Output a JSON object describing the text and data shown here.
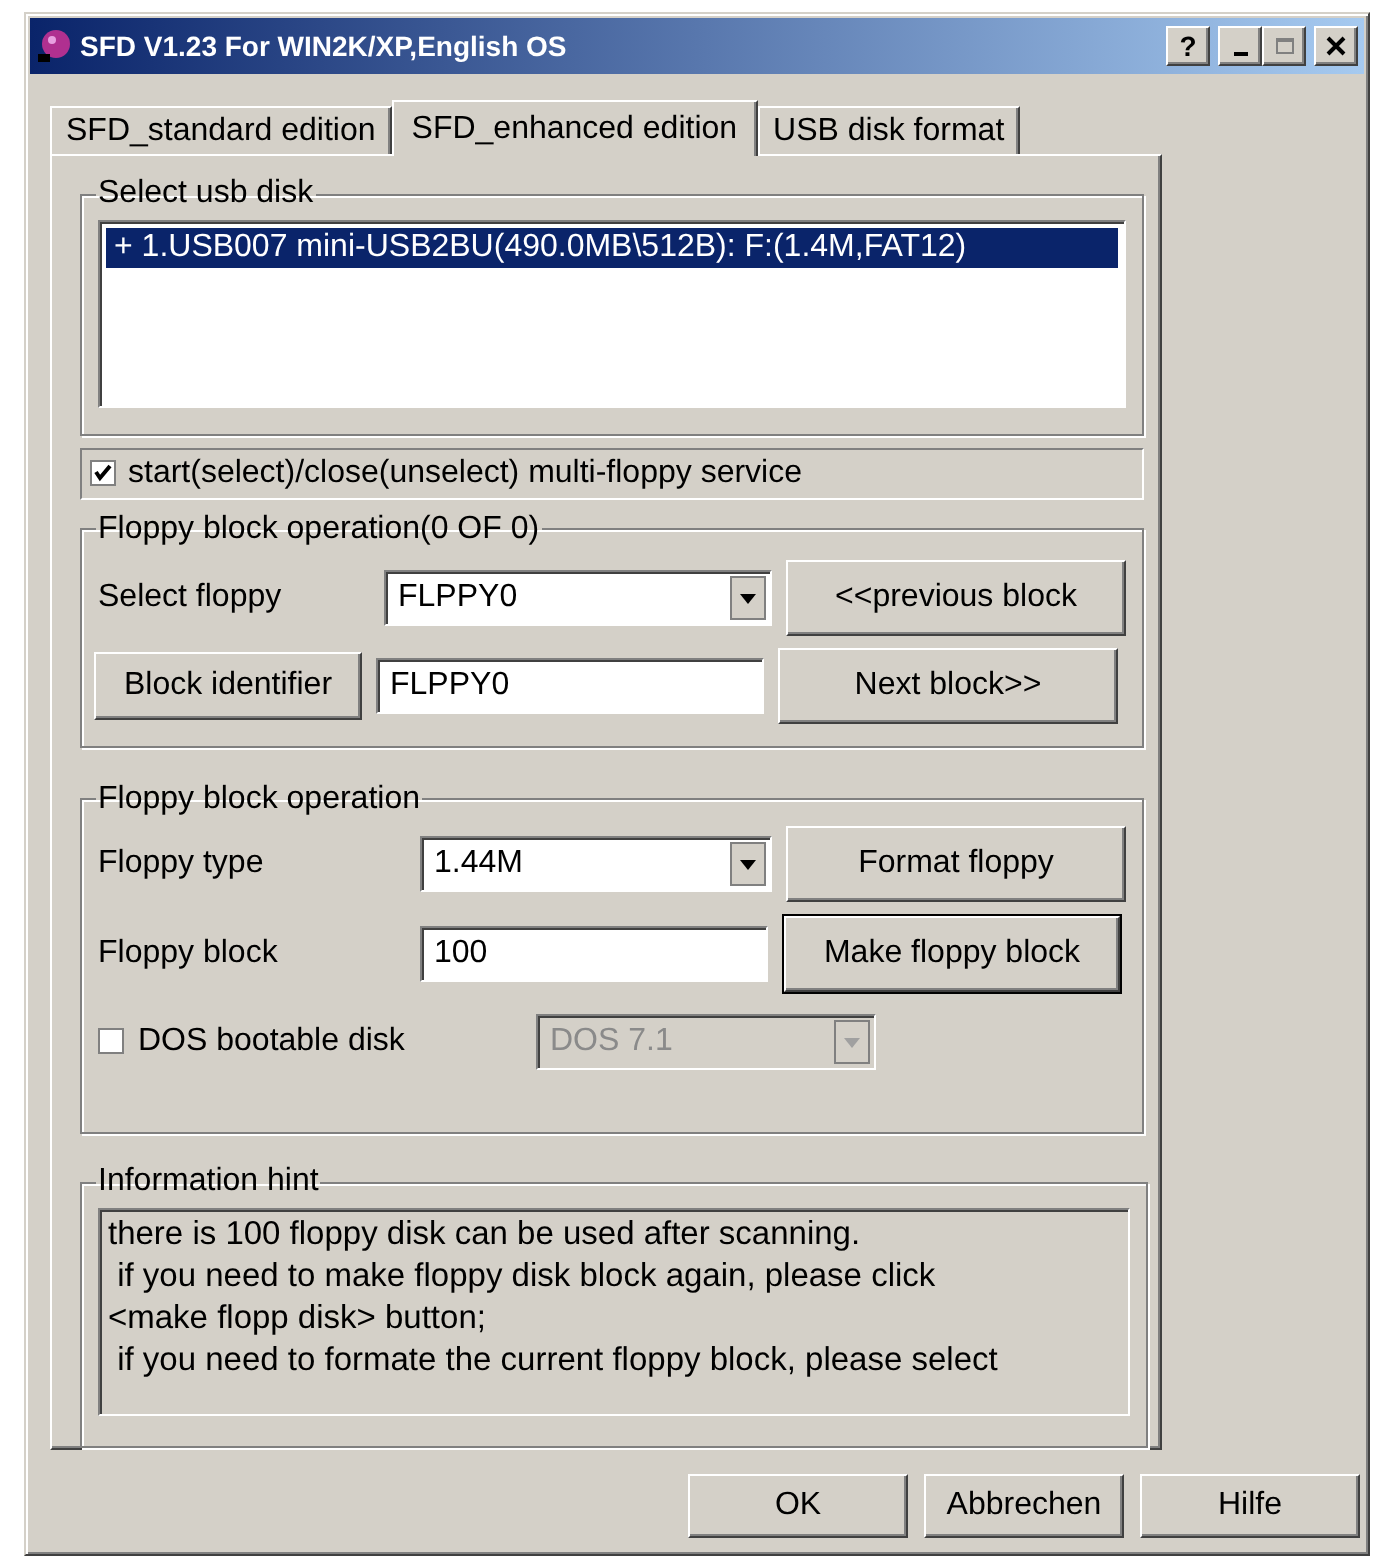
{
  "window": {
    "title": "SFD V1.23 For WIN2K/XP,English OS",
    "help_button": "?"
  },
  "tabs": [
    {
      "label": "SFD_standard edition",
      "selected": false
    },
    {
      "label": "SFD_enhanced edition",
      "selected": true
    },
    {
      "label": "USB disk format",
      "selected": false
    }
  ],
  "usb_disk": {
    "label": "Select usb disk",
    "items": [
      {
        "text": "+ 1.USB007 mini-USB2BU(490.0MB\\512B): F:(1.4M,FAT12)",
        "selected": true
      }
    ]
  },
  "service": {
    "label": "start(select)/close(unselect) multi-floppy service",
    "checked": true
  },
  "block_group": {
    "label": "Floppy block operation(0 OF 0)",
    "select_label": "Select floppy",
    "select_value": "FLPPY0",
    "previous_button": "<<previous block",
    "identifier_button": "Block identifier",
    "identifier_value": "FLPPY0",
    "next_button": "Next block>>"
  },
  "operation_group": {
    "label": "Floppy block operation",
    "type_label": "Floppy type",
    "type_value": "1.44M",
    "format_button": "Format floppy",
    "block_label": "Floppy block",
    "block_value": "100",
    "make_button": {
      "label": "Make floppy block",
      "default": true
    },
    "dos_bootable": {
      "label": "DOS bootable disk",
      "checked": false
    },
    "dos_version": {
      "value": "DOS 7.1",
      "disabled": true
    }
  },
  "hint": {
    "label": "Information hint",
    "text": "there is 100 floppy disk can be used after scanning.\n if you need to make floppy disk block again, please click\n<make flopp disk> button;\n if you need to formate the current floppy block, please select"
  },
  "buttons": [
    "OK",
    "Abbrechen",
    "Hilfe"
  ]
}
